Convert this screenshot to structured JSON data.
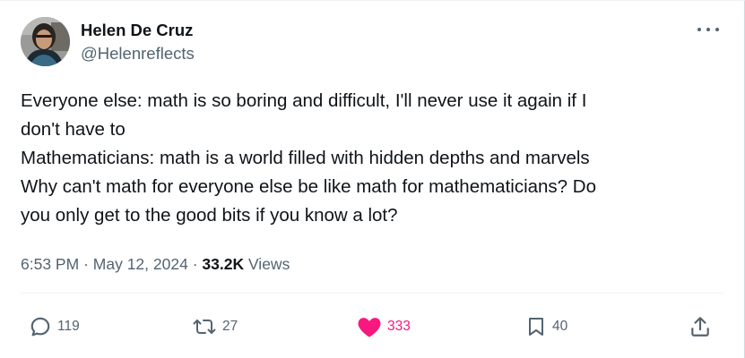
{
  "author": {
    "display_name": "Helen De Cruz",
    "handle": "@Helenreflects"
  },
  "tweet": {
    "lines": [
      "Everyone else: math is so boring and difficult, I'll never use it again if I",
      "don't have to",
      "Mathematicians: math is a world filled with hidden depths and marvels",
      "Why can't math for everyone else be like math for mathematicians? Do",
      "you only get to the good bits if you know a lot?"
    ]
  },
  "meta": {
    "time": "6:53 PM",
    "separator": "·",
    "date": "May 12, 2024",
    "views_count": "33.2K",
    "views_label": "Views"
  },
  "actions": {
    "reply_count": "119",
    "retweet_count": "27",
    "like_count": "333",
    "bookmark_count": "40"
  },
  "icons": {
    "more": "more-horizontal-icon",
    "reply": "reply-icon",
    "retweet": "retweet-icon",
    "like": "heart-filled-icon",
    "bookmark": "bookmark-icon",
    "share": "share-icon"
  },
  "colors": {
    "like_active": "#f91880",
    "secondary_text": "#536471",
    "primary_text": "#0f1419"
  }
}
